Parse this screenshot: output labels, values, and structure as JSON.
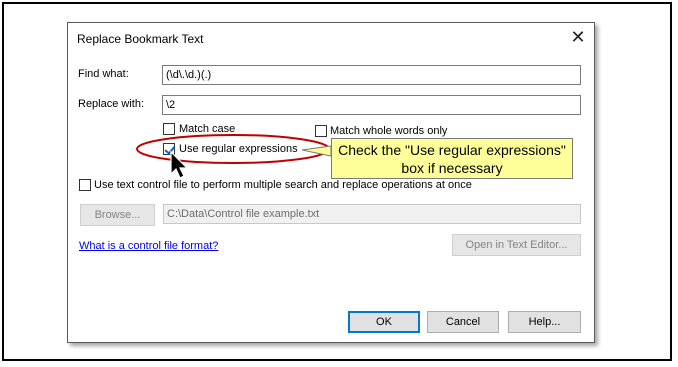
{
  "dialog": {
    "title": "Replace Bookmark Text",
    "close_glyph": "✕",
    "find_label": "Find what:",
    "find_value": "(\\d\\.\\d.)(.)",
    "replace_label": "Replace with:",
    "replace_value": "\\2",
    "match_case_label": "Match case",
    "match_case_checked": false,
    "match_whole_label": "Match whole words only",
    "match_whole_checked": false,
    "regex_label": "Use regular expressions",
    "regex_checked": true,
    "control_file_label": "Use text control file to perform multiple search and replace operations at once",
    "control_file_checked": false,
    "browse_label": "Browse...",
    "control_file_path": "C:\\Data\\Control file example.txt",
    "link_label": "What is a control file format?",
    "open_editor_label": "Open in Text Editor...",
    "ok_label": "OK",
    "cancel_label": "Cancel",
    "help_label": "Help..."
  },
  "annotation": {
    "callout_text": "Check the \"Use regular expressions\" box if necessary",
    "highlight_color": "#c00000",
    "callout_color": "#ffff99"
  },
  "icons": {
    "close": "close-icon",
    "cursor": "mouse-pointer-icon",
    "check": "checkmark-icon"
  }
}
